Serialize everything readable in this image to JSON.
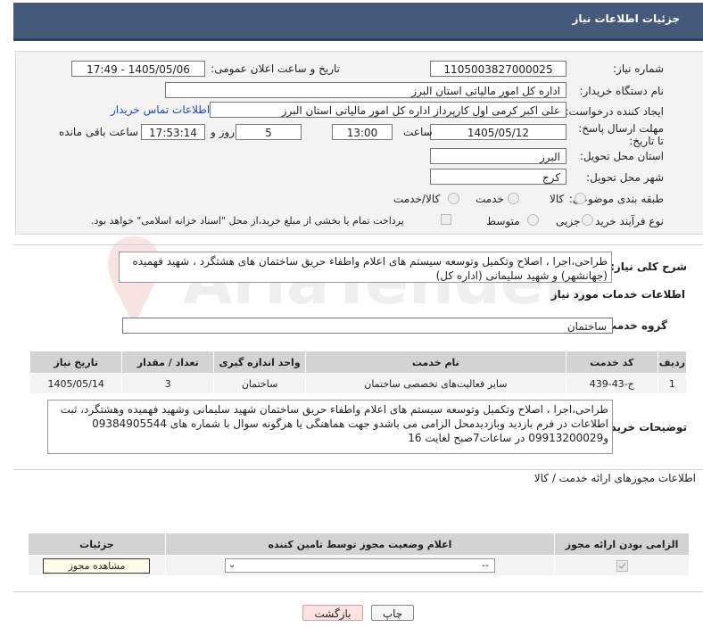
{
  "header": {
    "title": "جزئیات اطلاعات نیاز"
  },
  "form": {
    "need_number_label": "شماره نیاز:",
    "need_number": "1105003827000025",
    "announce_label": "تاریخ و ساعت اعلان عمومی:",
    "announce_value": "1405/05/06 - 17:49",
    "buyer_org_label": "نام دستگاه خریدار:",
    "buyer_org": "اداره کل امور مالیاتی استان البرز",
    "creator_label": "ایجاد کننده درخواست:",
    "creator": "علی اکبر کرمی اول کارپرداز اداره کل امور مالیاتی استان البرز",
    "buyer_contact_link": "اطلاعات تماس خریدار",
    "deadline_label": "مهلت ارسال پاسخ: تا تاریخ:",
    "deadline_date": "1405/05/12",
    "time_label": "ساعت",
    "deadline_time": "13:00",
    "days_value": "5",
    "days_label": "روز و",
    "remaining_time": "17:53:14",
    "remaining_label": "ساعت باقی مانده",
    "province_label": "استان محل تحویل:",
    "province": "البرز",
    "city_label": "شهر محل تحویل:",
    "city": "کرج",
    "category_label": "طبقه بندی موضوعی:",
    "category_options": [
      "کالا",
      "خدمت",
      "کالا/خدمت"
    ],
    "process_label": "نوع فرآیند خرید :",
    "process_options": [
      "جزیی",
      "متوسط"
    ],
    "payment_note": "پرداخت تمام یا بخشی از مبلغ خرید،از محل \"اسناد خزانه اسلامی\" خواهد بود."
  },
  "summary": {
    "label": "شرح کلی نیاز:",
    "text": "طراحی،اجرا ، اصلاح وتکمیل وتوسعه سیستم های اعلام واطفاء حریق ساختمان های هشتگرد ، شهید فهمیده (جهانشهر) و شهید سلیمانی (اداره کل)"
  },
  "services": {
    "section_title": "اطلاعات خدمات مورد نیاز",
    "group_label": "گروه خدمت:",
    "group_value": "ساختمان",
    "columns": [
      "ردیف",
      "کد خدمت",
      "نام خدمت",
      "واحد اندازه گیری",
      "تعداد / مقدار",
      "تاریخ نیاز"
    ],
    "rows": [
      [
        "1",
        "ج-43-439",
        "سایر فعالیت‌های تخصصی ساختمان",
        "ساختمان",
        "3",
        "1405/05/14"
      ]
    ]
  },
  "buyer_notes": {
    "label": "توضیحات خریدار:",
    "text": "طراحی،اجرا ، اصلاح وتکمیل وتوسعه سیستم های اعلام واطفاء حریق ساختمان شهید سلیمانی وشهید فهمیده وهشتگرد، ثبت اطلاعات در فرم بازدید وبازدیدمحل الزامی می باشدو جهت هماهنگی یا هرگونه سوال با شماره های 09384905544 و09913200029 در ساعات7صبح لغایت 16"
  },
  "permits": {
    "section_title": "اطلاعات مجوزهای ارائه خدمت / کالا",
    "columns": [
      "الزامی بودن ارائه مجوز",
      "اعلام وضعیت مجوز توسط تامین کننده",
      "جزئیات"
    ],
    "select_value": "--",
    "view_button": "مشاهده مجوز"
  },
  "footer": {
    "print_button": "چاپ",
    "back_button": "بازگشت"
  },
  "watermark_text": "AriaTender.neT"
}
